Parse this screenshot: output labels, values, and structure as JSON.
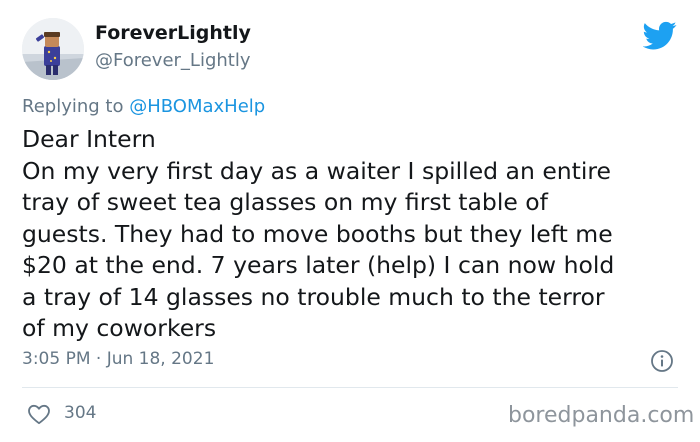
{
  "author": {
    "display_name": "ForeverLightly",
    "handle": "@Forever_Lightly"
  },
  "reply": {
    "prefix": "Replying to",
    "mention": "@HBOMaxHelp"
  },
  "tweet": {
    "lines": [
      "Dear Intern",
      "On my very first day as a waiter I spilled an entire",
      "tray of sweet tea glasses on my first table of",
      "guests. They had to move booths but they left me",
      "$20 at the end. 7 years later (help) I can now hold",
      "a tray of 14 glasses no trouble much to the terror",
      "of my coworkers"
    ],
    "timestamp": "3:05 PM · Jun 18, 2021"
  },
  "engagement": {
    "likes": "304"
  },
  "watermark": "boredpanda.com",
  "colors": {
    "twitter_blue": "#1da1f2",
    "link_blue": "#1b95e0",
    "secondary_text": "#657786",
    "divider": "#e1e8ed"
  },
  "icons": [
    "twitter-bird-icon",
    "info-icon",
    "heart-icon"
  ]
}
